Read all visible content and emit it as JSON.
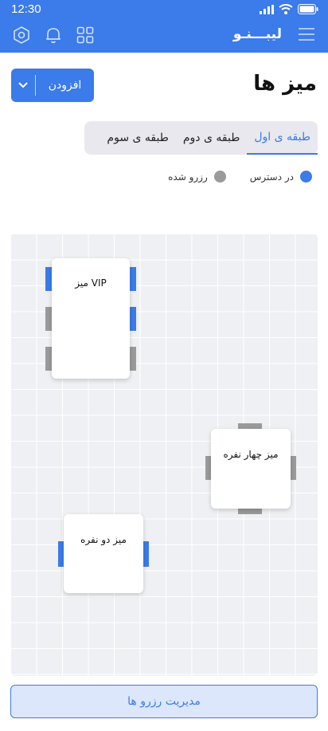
{
  "status_bar": {
    "time": "12:30"
  },
  "app_bar": {
    "brand": "لیبـــنـو"
  },
  "page": {
    "title": "میز ها",
    "add_label": "افزودن"
  },
  "tabs": [
    {
      "label": "طبقه ی اول",
      "active": true
    },
    {
      "label": "طبقه ی دوم",
      "active": false
    },
    {
      "label": "طبقه ی سوم",
      "active": false
    }
  ],
  "legend": [
    {
      "label": "در دسترس",
      "color": "#3b7bea"
    },
    {
      "label": "رزرو شده",
      "color": "#9a9a9a"
    }
  ],
  "tables": [
    {
      "label": "میز VIP",
      "seats_available": 3,
      "seats_booked": 3
    },
    {
      "label": "میز چهار نفره",
      "seats_available": 0,
      "seats_booked": 4
    },
    {
      "label": "میز دو نفره",
      "seats_available": 2,
      "seats_booked": 0
    }
  ],
  "footer": {
    "manage_label": "مدیریت رزرو ها"
  },
  "colors": {
    "primary": "#3b7bea",
    "booked": "#9a9a9a",
    "floor": "#eef0f3"
  }
}
